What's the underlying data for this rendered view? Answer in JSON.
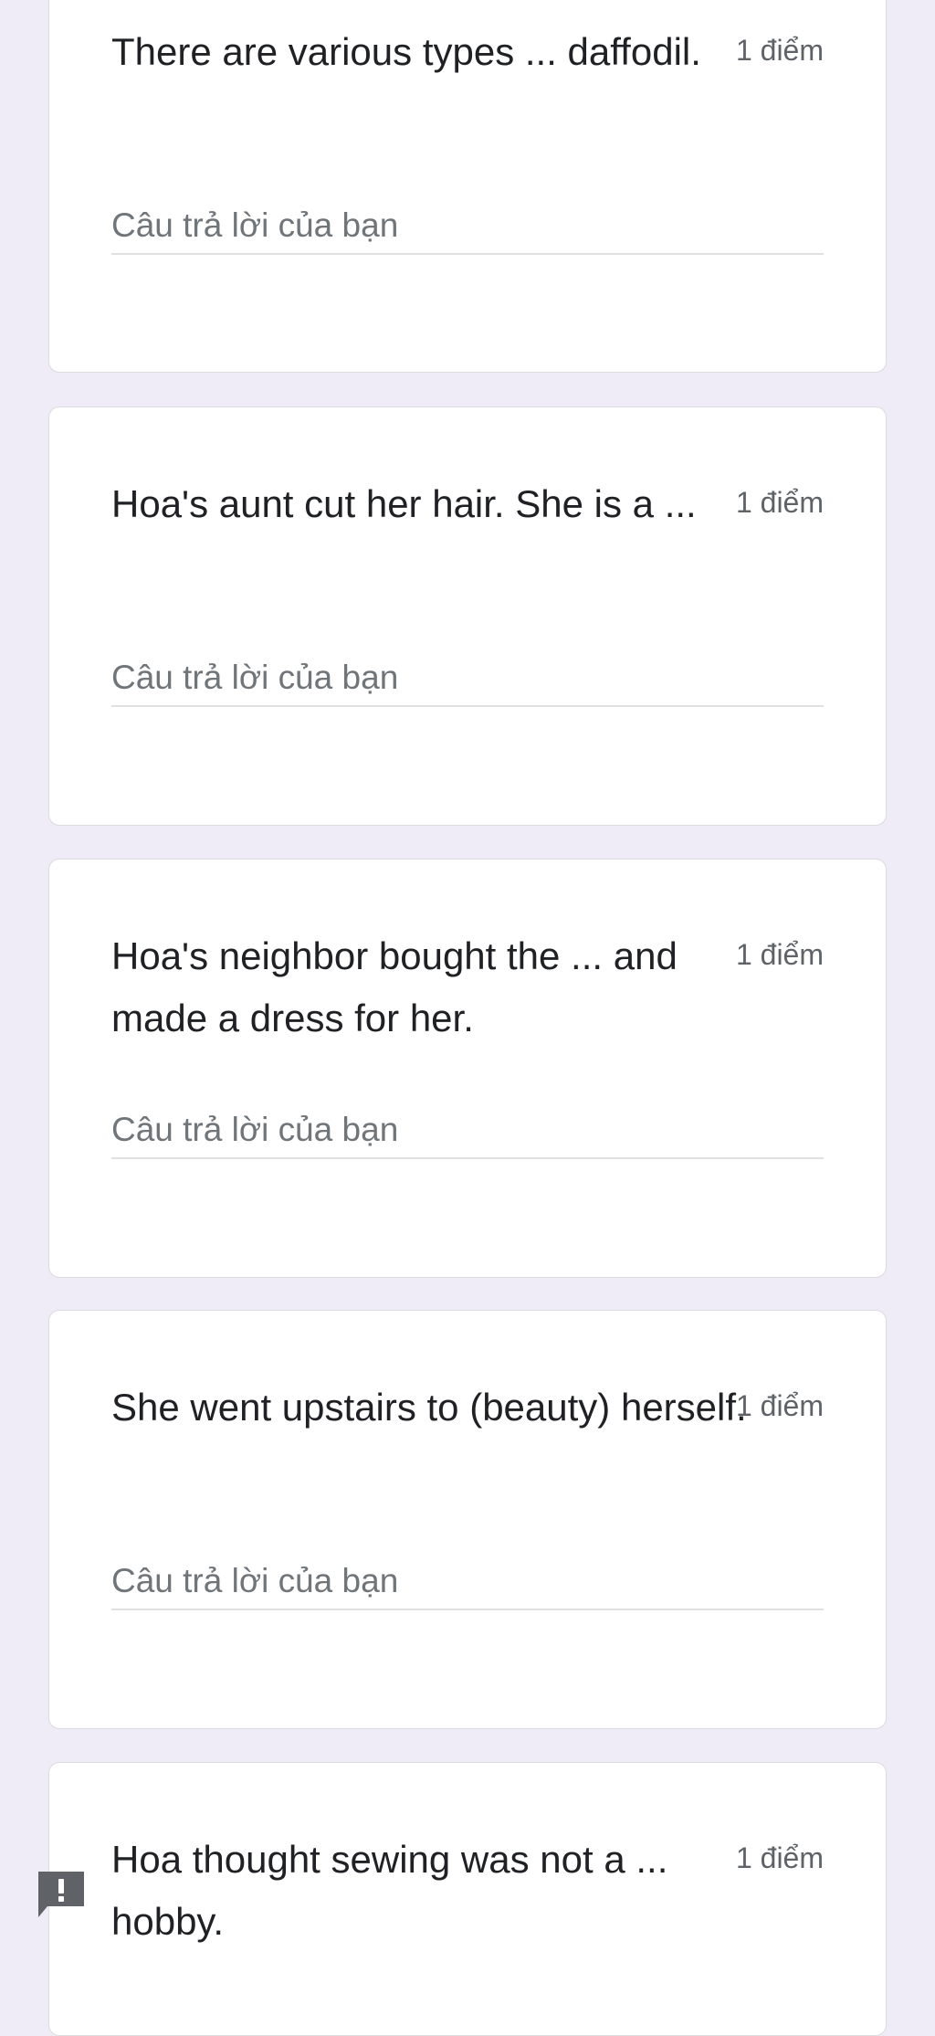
{
  "answer_placeholder": "Câu trả lời của bạn",
  "questions": [
    {
      "text": "There are various types ... daffodil.",
      "points": "1 điểm"
    },
    {
      "text": "Hoa's aunt cut her hair. She is a ...",
      "points": "1 điểm"
    },
    {
      "text": "Hoa's neighbor bought the ... and made a dress for her.",
      "points": "1 điểm"
    },
    {
      "text": "She went upstairs to (beauty) herself.",
      "points": "1 điểm"
    },
    {
      "text": "Hoa thought sewing was not a ... hobby.",
      "points": "1 điểm"
    }
  ],
  "icons": {
    "report": "report-feedback-icon"
  },
  "colors": {
    "background": "#efebf7",
    "card": "#ffffff",
    "report_icon": "#5f6368"
  }
}
